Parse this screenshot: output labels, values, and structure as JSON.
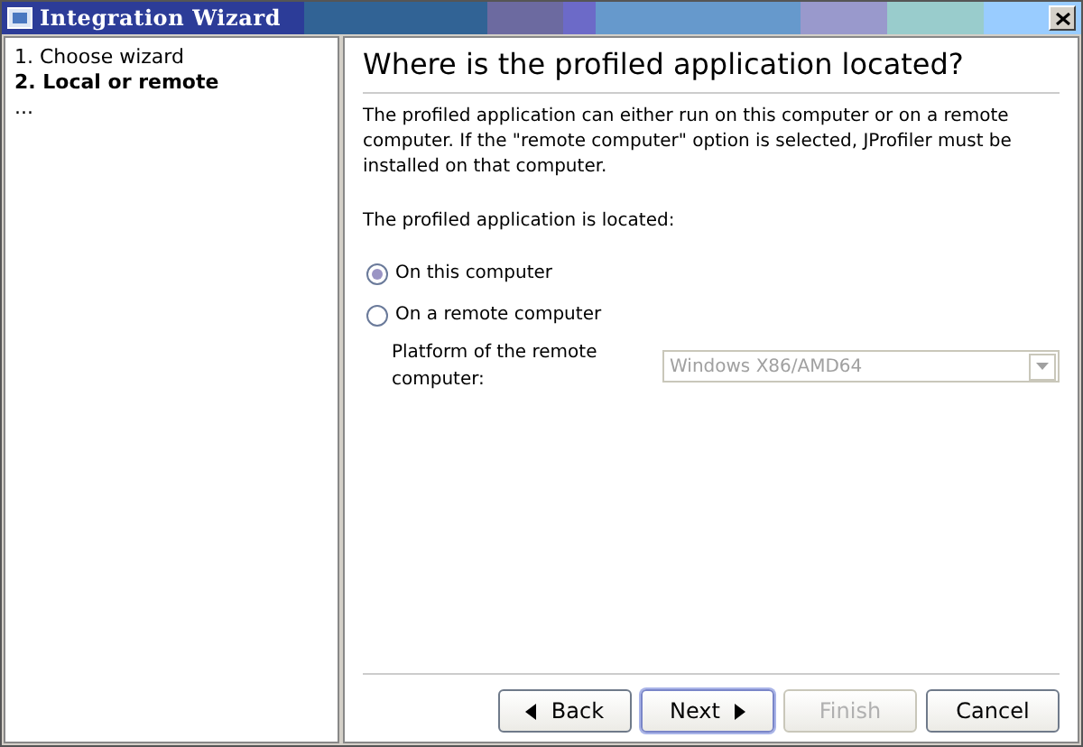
{
  "window": {
    "title": "Integration Wizard"
  },
  "steps": [
    {
      "label": "1. Choose wizard",
      "selected": false
    },
    {
      "label": "2. Local or remote",
      "selected": true
    },
    {
      "label": "...",
      "selected": false
    }
  ],
  "heading": "Where is the profiled application located?",
  "description": "The profiled application can either run on this computer or on a remote computer. If the \"remote computer\" option is selected, JProfiler must be installed on that computer.",
  "prompt": "The profiled application is located:",
  "options": [
    {
      "label": "On this computer",
      "selected": true
    },
    {
      "label": "On a remote computer",
      "selected": false
    }
  ],
  "platform": {
    "label": "Platform of the remote computer:",
    "value": "Windows X86/AMD64",
    "disabled": true
  },
  "buttons": [
    {
      "label": "Back",
      "kind": "back",
      "disabled": false,
      "focused": false
    },
    {
      "label": "Next",
      "kind": "next",
      "disabled": false,
      "focused": true
    },
    {
      "label": "Finish",
      "kind": "plain",
      "disabled": true,
      "focused": false
    },
    {
      "label": "Cancel",
      "kind": "plain",
      "disabled": false,
      "focused": false
    }
  ]
}
